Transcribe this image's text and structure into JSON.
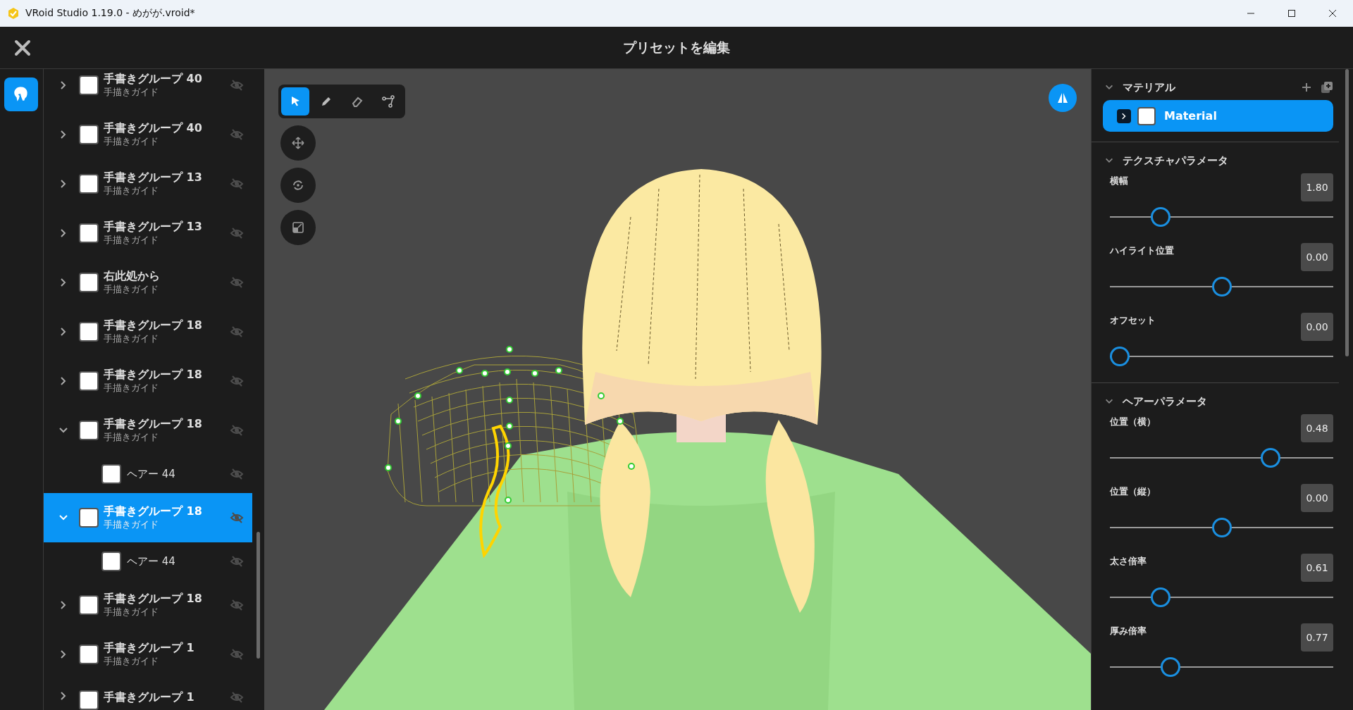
{
  "window": {
    "title": "VRoid Studio 1.19.0 - めがが.vroid*"
  },
  "header": {
    "title": "プリセットを編集"
  },
  "tree": [
    {
      "label": "手書きグループ 40",
      "sublabel": "手描きガイド",
      "expanded": false,
      "selected": false
    },
    {
      "label": "手書きグループ 40",
      "sublabel": "手描きガイド",
      "expanded": false,
      "selected": false
    },
    {
      "label": "手書きグループ 13",
      "sublabel": "手描きガイド",
      "expanded": false,
      "selected": false
    },
    {
      "label": "手書きグループ 13",
      "sublabel": "手描きガイド",
      "expanded": false,
      "selected": false
    },
    {
      "label": "右此処から",
      "sublabel": "手描きガイド",
      "expanded": false,
      "selected": false
    },
    {
      "label": "手書きグループ 18",
      "sublabel": "手描きガイド",
      "expanded": false,
      "selected": false
    },
    {
      "label": "手書きグループ 18",
      "sublabel": "手描きガイド",
      "expanded": false,
      "selected": false
    },
    {
      "label": "手書きグループ 18",
      "sublabel": "手描きガイド",
      "expanded": true,
      "selected": false,
      "children": [
        {
          "label": "ヘアー 44",
          "selected": false
        }
      ]
    },
    {
      "label": "手書きグループ 18",
      "sublabel": "手描きガイド",
      "expanded": true,
      "selected": true,
      "children": [
        {
          "label": "ヘアー 44",
          "selected": false
        }
      ]
    },
    {
      "label": "手書きグループ 18",
      "sublabel": "手描きガイド",
      "expanded": false,
      "selected": false
    },
    {
      "label": "手書きグループ 1",
      "sublabel": "手描きガイド",
      "expanded": false,
      "selected": false
    },
    {
      "label": "手書きグループ 1",
      "expanded": false,
      "selected": false
    }
  ],
  "viewport": {
    "tools": [
      {
        "kind": "select",
        "selected": true
      },
      {
        "kind": "pen",
        "selected": false
      },
      {
        "kind": "eraser",
        "selected": false
      },
      {
        "kind": "path",
        "selected": false
      }
    ]
  },
  "material": {
    "title": "マテリアル",
    "expanded": true,
    "items": [
      {
        "label": "Material",
        "expanded": false,
        "selected": true
      }
    ]
  },
  "texture_parameters": {
    "title": "テクスチャパラメータ",
    "expanded": true,
    "sliders": [
      {
        "label": "横幅",
        "value": "1.80",
        "level": 0.2
      },
      {
        "label": "ハイライト位置",
        "value": "0.00",
        "level": 0.5
      },
      {
        "label": "オフセット",
        "value": "0.00",
        "level": 0
      }
    ]
  },
  "hair_parameters": {
    "title": "ヘアーパラメータ",
    "expanded": true,
    "sliders": [
      {
        "label": "位置（横）",
        "value": "0.48",
        "level": 0.74
      },
      {
        "label": "位置（縦）",
        "value": "0.00",
        "level": 0.5
      },
      {
        "label": "太さ倍率",
        "value": "0.61",
        "level": 0.2
      },
      {
        "label": "厚み倍率",
        "value": "0.77",
        "level": 0.25
      }
    ]
  }
}
